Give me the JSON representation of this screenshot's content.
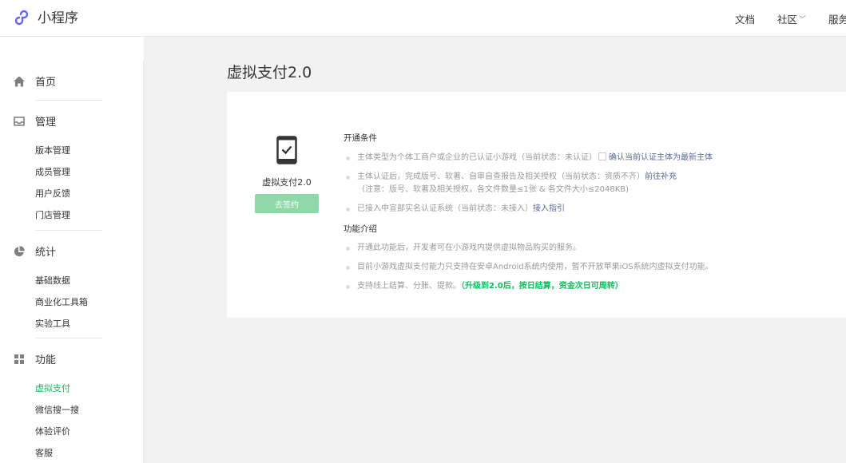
{
  "header": {
    "logo_text": "小程序",
    "nav": [
      {
        "label": "文档"
      },
      {
        "label": "社区",
        "has_dropdown": true
      },
      {
        "label": "服务"
      }
    ]
  },
  "sidebar": {
    "sections": [
      {
        "label": "首页",
        "icon": "home-icon",
        "items": []
      },
      {
        "label": "管理",
        "icon": "inbox-icon",
        "items": [
          "版本管理",
          "成员管理",
          "用户反馈",
          "门店管理"
        ]
      },
      {
        "label": "统计",
        "icon": "pie-chart-icon",
        "items": [
          "基础数据",
          "商业化工具箱",
          "实验工具"
        ]
      },
      {
        "label": "功能",
        "icon": "grid-icon",
        "items": [
          "虚拟支付",
          "微信搜一搜",
          "体验评价",
          "客服"
        ]
      }
    ],
    "active_item": "虚拟支付",
    "active_color": "#07c160"
  },
  "main": {
    "page_title": "虚拟支付2.0",
    "service": {
      "name": "虚拟支付2.0",
      "icon": "phone-check-icon",
      "button_label": "去签约"
    },
    "conditions": {
      "title": "开通条件",
      "items": [
        {
          "text": "主体类型为个体工商户或企业的已认证小游戏（当前状态：未认证）",
          "checkbox_label": "确认当前认证主体为最新主体"
        },
        {
          "text": "主体认证后，完成版号、软著、自审自查报告及相关授权（当前状态：资质不齐）",
          "link": "前往补充",
          "note": "（注意：版号、软著及相关授权，各文件数量≤1张 & 各文件大小≤2048KB)"
        },
        {
          "text": "已接入中宣部实名认证系统（当前状态：未接入）",
          "link": "接入指引"
        }
      ]
    },
    "intro": {
      "title": "功能介绍",
      "items": [
        {
          "text": "开通此功能后，开发者可在小游戏内提供虚拟物品购买的服务。"
        },
        {
          "text": "目前小游戏虚拟支付能力只支持在安卓Android系统内使用，暂不开放苹果iOS系统内虚拟支付功能。"
        },
        {
          "text": "支持线上结算、分账、提款。",
          "highlight": "（升级到2.0后，按日结算，资金次日可周转）"
        }
      ]
    }
  }
}
